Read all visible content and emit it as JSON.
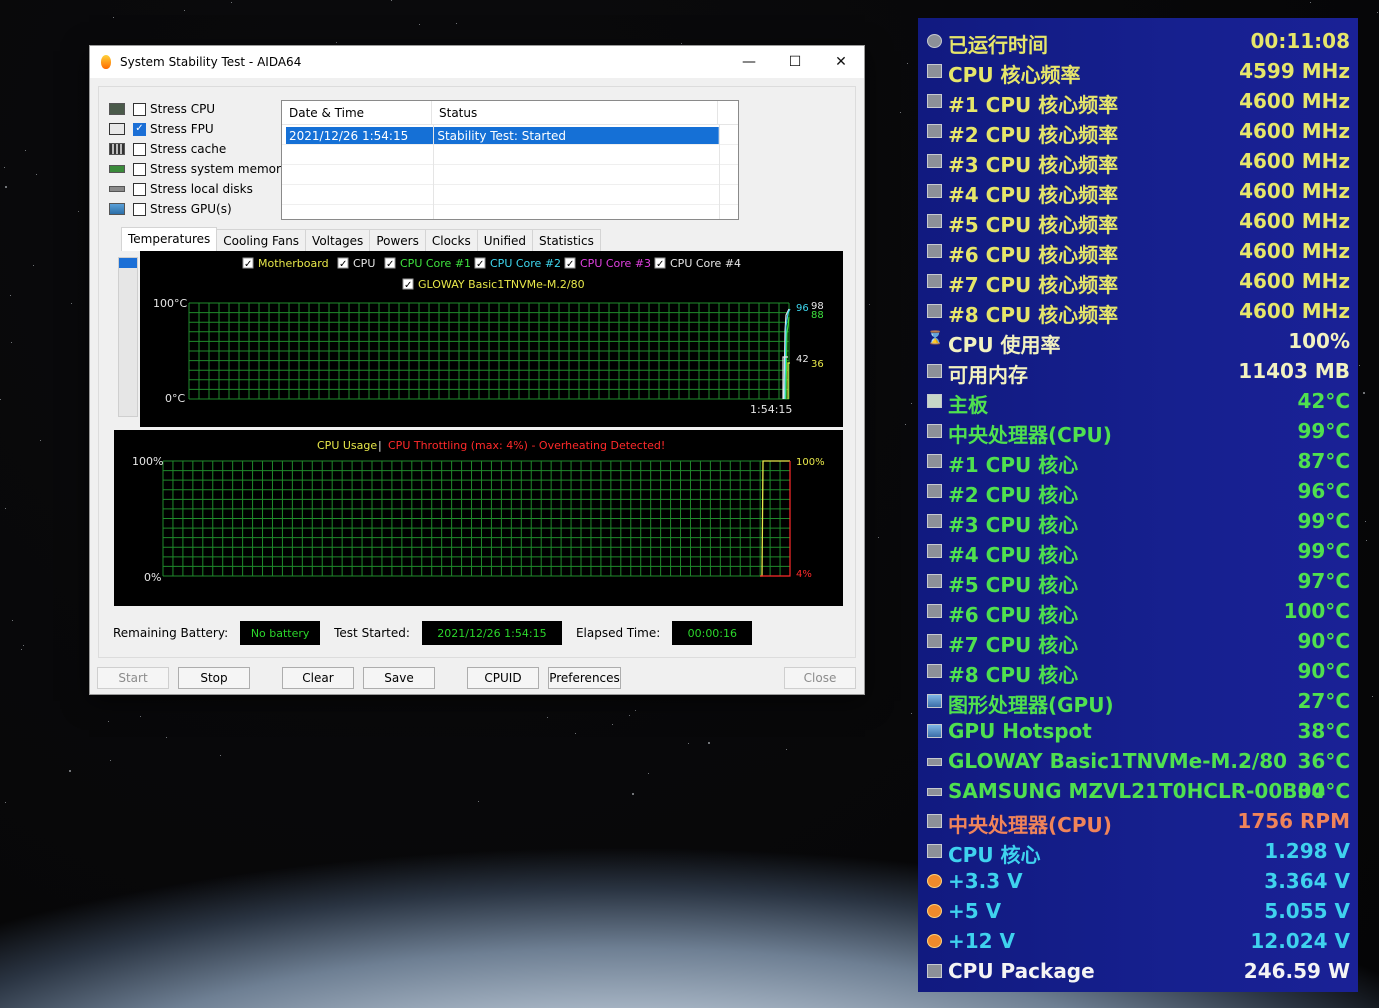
{
  "window": {
    "title": "System Stability Test - AIDA64",
    "minimize": "—",
    "maximize": "☐",
    "close": "✕"
  },
  "stress": [
    {
      "label": "Stress CPU",
      "checked": false,
      "icon": "cpu-icon"
    },
    {
      "label": "Stress FPU",
      "checked": true,
      "icon": "fpu-icon"
    },
    {
      "label": "Stress cache",
      "checked": false,
      "icon": "cache-icon"
    },
    {
      "label": "Stress system memory",
      "checked": false,
      "icon": "memory-icon"
    },
    {
      "label": "Stress local disks",
      "checked": false,
      "icon": "disk-icon"
    },
    {
      "label": "Stress GPU(s)",
      "checked": false,
      "icon": "gpu-icon"
    }
  ],
  "log": {
    "headers": [
      "Date & Time",
      "Status"
    ],
    "rows": [
      {
        "datetime": "2021/12/26 1:54:15",
        "status": "Stability Test: Started"
      }
    ]
  },
  "tabs": [
    "Temperatures",
    "Cooling Fans",
    "Voltages",
    "Powers",
    "Clocks",
    "Unified",
    "Statistics"
  ],
  "temp_chart": {
    "legend": [
      {
        "label": "Motherboard",
        "color": "#e8e84a"
      },
      {
        "label": "CPU",
        "color": "#e6e6e6"
      },
      {
        "label": "CPU Core #1",
        "color": "#3ee23e"
      },
      {
        "label": "CPU Core #2",
        "color": "#3ed7ef"
      },
      {
        "label": "CPU Core #3",
        "color": "#e040e0"
      },
      {
        "label": "CPU Core #4",
        "color": "#e6e6e6"
      },
      {
        "label": "GLOWAY Basic1TNVMe-M.2/80",
        "color": "#e8e84a"
      }
    ],
    "ymax_label": "100°C",
    "ymin_label": "0°C",
    "time_label": "1:54:15",
    "right_labels": [
      {
        "text": "96",
        "color": "#3ed7ef"
      },
      {
        "text": "98",
        "color": "#e6e6e6"
      },
      {
        "text": "88",
        "color": "#3ee23e"
      },
      {
        "text": "42",
        "color": "#e6e6e6"
      },
      {
        "text": "36",
        "color": "#e8e84a"
      }
    ]
  },
  "usage_chart": {
    "title_usage": "CPU Usage",
    "separator": "|",
    "title_throttle": "CPU Throttling (max: 4%) - Overheating Detected!",
    "ymax_label": "100%",
    "ymin_label": "0%",
    "right_top": "100%",
    "right_bottom": "4%"
  },
  "status": {
    "battery_label": "Remaining Battery:",
    "battery_value": "No battery",
    "started_label": "Test Started:",
    "started_value": "2021/12/26 1:54:15",
    "elapsed_label": "Elapsed Time:",
    "elapsed_value": "00:00:16"
  },
  "buttons": {
    "start": "Start",
    "stop": "Stop",
    "clear": "Clear",
    "save": "Save",
    "cpuid": "CPUID",
    "preferences": "Preferences",
    "close": "Close"
  },
  "sensors": [
    {
      "label": "已运行时间",
      "value": "00:11:08",
      "color": "#e6e66a",
      "icon": "clock-icon"
    },
    {
      "label": "CPU 核心频率",
      "value": "4599 MHz",
      "color": "#e6e66a",
      "icon": "chip-icon"
    },
    {
      "label": "#1 CPU 核心频率",
      "value": "4600 MHz",
      "color": "#e6e66a",
      "icon": "chip-icon"
    },
    {
      "label": "#2 CPU 核心频率",
      "value": "4600 MHz",
      "color": "#e6e66a",
      "icon": "chip-icon"
    },
    {
      "label": "#3 CPU 核心频率",
      "value": "4600 MHz",
      "color": "#e6e66a",
      "icon": "chip-icon"
    },
    {
      "label": "#4 CPU 核心频率",
      "value": "4600 MHz",
      "color": "#e6e66a",
      "icon": "chip-icon"
    },
    {
      "label": "#5 CPU 核心频率",
      "value": "4600 MHz",
      "color": "#e6e66a",
      "icon": "chip-icon"
    },
    {
      "label": "#6 CPU 核心频率",
      "value": "4600 MHz",
      "color": "#e6e66a",
      "icon": "chip-icon"
    },
    {
      "label": "#7 CPU 核心频率",
      "value": "4600 MHz",
      "color": "#e6e66a",
      "icon": "chip-icon"
    },
    {
      "label": "#8 CPU 核心频率",
      "value": "4600 MHz",
      "color": "#e6e66a",
      "icon": "chip-icon"
    },
    {
      "label": "CPU 使用率",
      "value": "100%",
      "color": "#f2f2c0",
      "icon": "hourglass-icon"
    },
    {
      "label": "可用内存",
      "value": "11403 MB",
      "color": "#f2f2c0",
      "icon": "memory-icon"
    },
    {
      "label": "主板",
      "value": "42°C",
      "color": "#4fe04f",
      "icon": "motherboard-icon"
    },
    {
      "label": "中央处理器(CPU)",
      "value": "99°C",
      "color": "#4fe04f",
      "icon": "chip-icon"
    },
    {
      "label": " #1 CPU 核心",
      "value": "87°C",
      "color": "#4fe04f",
      "icon": "chip-icon"
    },
    {
      "label": " #2 CPU 核心",
      "value": "96°C",
      "color": "#4fe04f",
      "icon": "chip-icon"
    },
    {
      "label": " #3 CPU 核心",
      "value": "99°C",
      "color": "#4fe04f",
      "icon": "chip-icon"
    },
    {
      "label": " #4 CPU 核心",
      "value": "99°C",
      "color": "#4fe04f",
      "icon": "chip-icon"
    },
    {
      "label": " #5 CPU 核心",
      "value": "97°C",
      "color": "#4fe04f",
      "icon": "chip-icon"
    },
    {
      "label": " #6 CPU 核心",
      "value": "100°C",
      "color": "#4fe04f",
      "icon": "chip-icon"
    },
    {
      "label": " #7 CPU 核心",
      "value": "90°C",
      "color": "#4fe04f",
      "icon": "chip-icon"
    },
    {
      "label": " #8 CPU 核心",
      "value": "90°C",
      "color": "#4fe04f",
      "icon": "chip-icon"
    },
    {
      "label": "图形处理器(GPU)",
      "value": "27°C",
      "color": "#4fe04f",
      "icon": "gpu-icon"
    },
    {
      "label": "GPU Hotspot",
      "value": "38°C",
      "color": "#4fe04f",
      "icon": "gpu-icon"
    },
    {
      "label": "GLOWAY Basic1TNVMe-M.2/80",
      "value": "36°C",
      "color": "#4fe04f",
      "icon": "disk-icon"
    },
    {
      "label": "SAMSUNG MZVL21T0HCLR-00B00",
      "value": "34°C",
      "color": "#4fe04f",
      "icon": "disk-icon"
    },
    {
      "label": "中央处理器(CPU)",
      "value": "1756 RPM",
      "color": "#f0845a",
      "icon": "chip-icon"
    },
    {
      "label": "CPU 核心",
      "value": "1.298 V",
      "color": "#3fd2ee",
      "icon": "chip-icon"
    },
    {
      "label": "+3.3 V",
      "value": "3.364 V",
      "color": "#3fd2ee",
      "icon": "voltage-icon"
    },
    {
      "label": "+5 V",
      "value": "5.055 V",
      "color": "#3fd2ee",
      "icon": "voltage-icon"
    },
    {
      "label": "+12 V",
      "value": "12.024 V",
      "color": "#3fd2ee",
      "icon": "voltage-icon"
    },
    {
      "label": "CPU Package",
      "value": "246.59 W",
      "color": "#f4f4f4",
      "icon": "chip-icon"
    }
  ]
}
